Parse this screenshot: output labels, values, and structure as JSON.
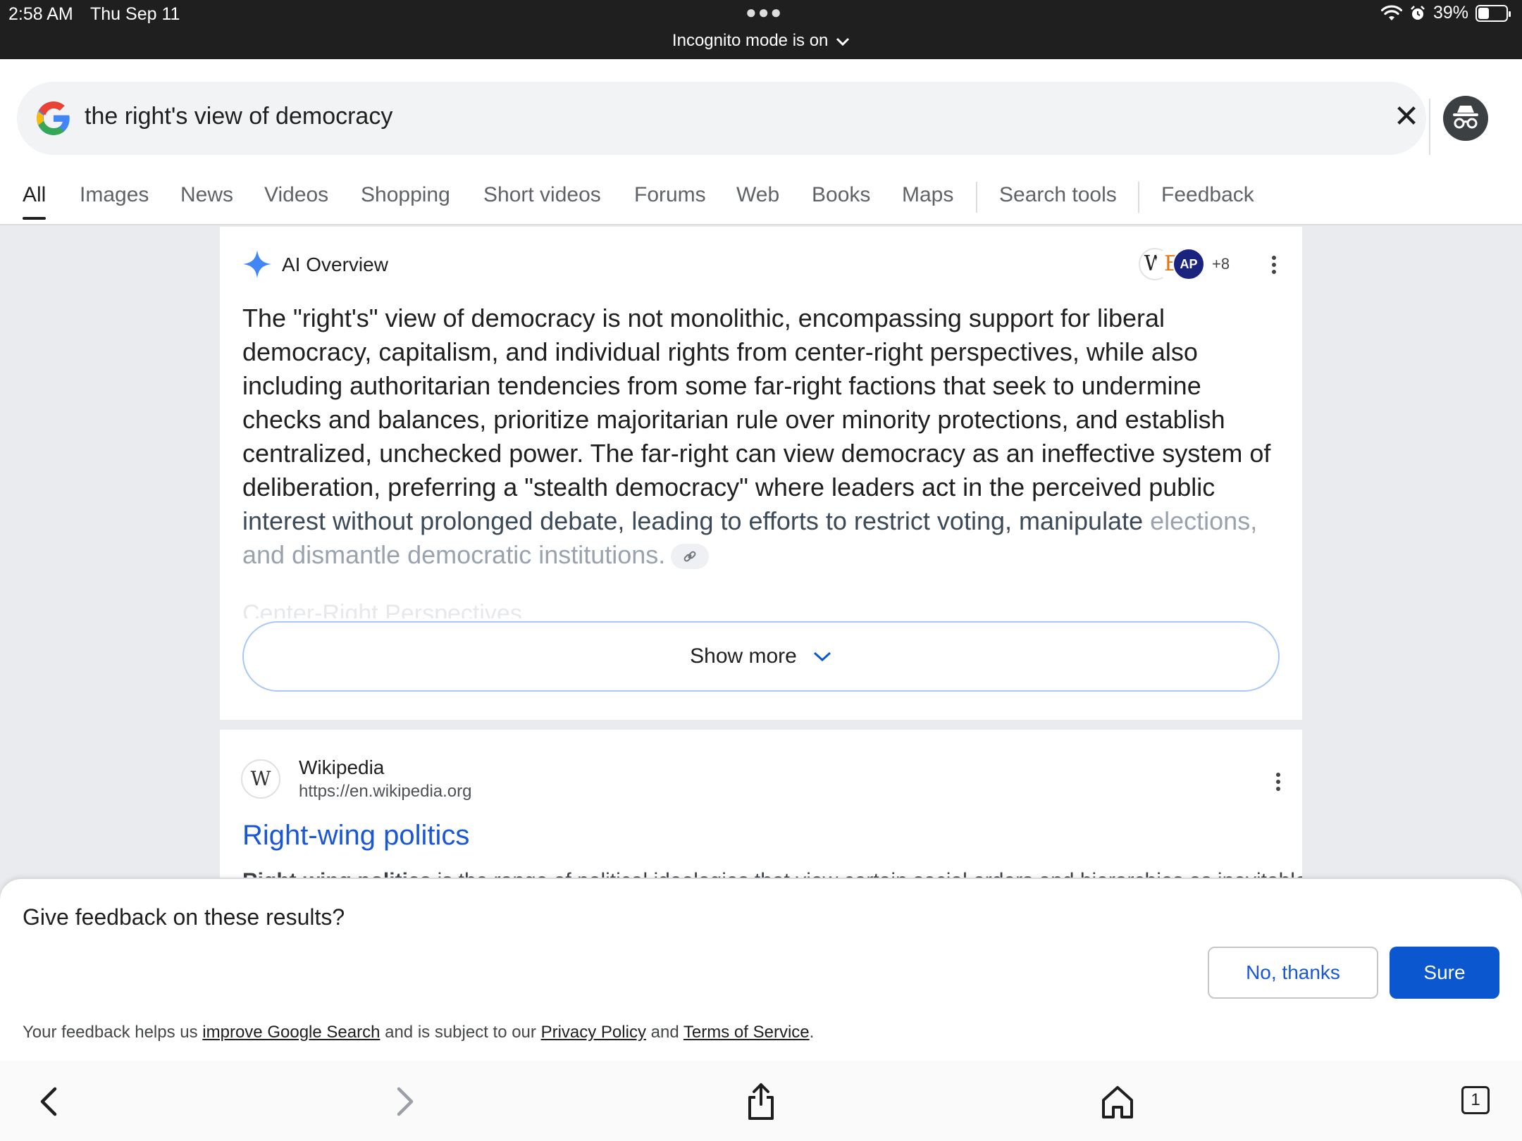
{
  "status_bar": {
    "time": "2:58 AM",
    "date": "Thu Sep 11",
    "battery": "39%",
    "battery_level": 0.39,
    "incognito_label": "Incognito mode is on"
  },
  "search": {
    "query": "the right's view of democracy"
  },
  "tabs": [
    {
      "label": "All"
    },
    {
      "label": "Images"
    },
    {
      "label": "News"
    },
    {
      "label": "Videos"
    },
    {
      "label": "Shopping"
    },
    {
      "label": "Short videos"
    },
    {
      "label": "Forums"
    },
    {
      "label": "Web"
    },
    {
      "label": "Books"
    },
    {
      "label": "Maps"
    },
    {
      "label": "Search tools"
    },
    {
      "label": "Feedback"
    }
  ],
  "ai_overview": {
    "title": "AI Overview",
    "sources": [
      {
        "label": "W",
        "color": "#ffffff",
        "text_color": "#222222"
      },
      {
        "label": "E",
        "color": "#ffffff",
        "text_color": "#e8710a"
      },
      {
        "label": "AP",
        "color": "#1a237e",
        "text_color": "#ffffff"
      }
    ],
    "sources_more": "+8",
    "text_main": "The \"right's\" view of democracy is not monolithic, encompassing support for liberal democracy, capitalism, and individual rights from center-right perspectives, while also including authoritarian tendencies from some far-right factions that seek to undermine checks and balances, prioritize majoritarian rule over minority protections, and establish centralized, unchecked power. The far-right can view democracy as an ineffective system of deliberation, preferring a \"stealth democracy\" where leaders act in the perceived public",
    "text_fade1": " interest without prolonged debate, leading to efforts to restrict voting, manipulate",
    "text_fade2": " elections, and dismantle democratic institutions.",
    "ghost_heading": "Center-Right Perspectives",
    "show_more": "Show more"
  },
  "result": {
    "site_name": "Wikipedia",
    "url": "https://en.wikipedia.org",
    "title": "Right-wing politics",
    "snippet_bold": "Right-wing politics",
    "snippet_rest": " is the range of political ideologies that view certain social orders and hierarchies as inevitable"
  },
  "feedback": {
    "question": "Give feedback on these results?",
    "no_label": "No, thanks",
    "sure_label": "Sure",
    "foot_1": "Your feedback helps us ",
    "foot_link1": "improve Google Search",
    "foot_2": " and is subject to our ",
    "foot_link2": "Privacy Policy",
    "foot_3": " and ",
    "foot_link3": "Terms of Service",
    "foot_4": "."
  },
  "toolbar": {
    "tab_count": "1"
  },
  "colors": {
    "link_blue": "#1a57d6",
    "primary_button": "#0b57d0",
    "ai_star": "#4285f4"
  }
}
